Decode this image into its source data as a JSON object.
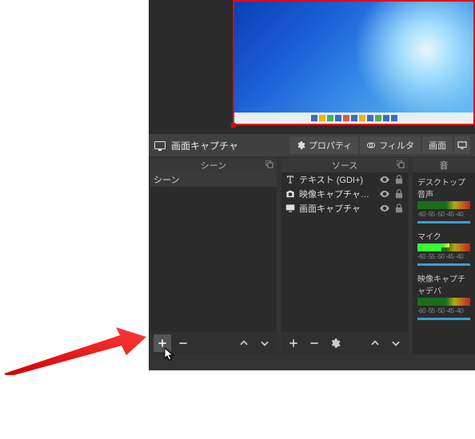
{
  "status": {
    "title": "画面キャプチャ"
  },
  "buttons": {
    "properties": "プロパティ",
    "filter": "フィルタ",
    "screen": "画面"
  },
  "panels": {
    "scenes": {
      "title": "シーン",
      "items": [
        "シーン"
      ]
    },
    "sources": {
      "title": "ソース",
      "items": [
        {
          "icon": "text",
          "label": "テキスト (GDI+)"
        },
        {
          "icon": "camera",
          "label": "映像キャプチャデバ"
        },
        {
          "icon": "monitor",
          "label": "画面キャプチャ"
        }
      ]
    },
    "mixer": {
      "title": "音",
      "tracks": [
        {
          "label": "デスクトップ音声",
          "scale": "-60 -55 -50 -45 -40"
        },
        {
          "label": "マイク",
          "scale": "-60 -55 -50 -45 -40"
        },
        {
          "label": "映像キャプチャデバ",
          "scale": "-60 -55 -50 -45 -40"
        }
      ]
    }
  }
}
